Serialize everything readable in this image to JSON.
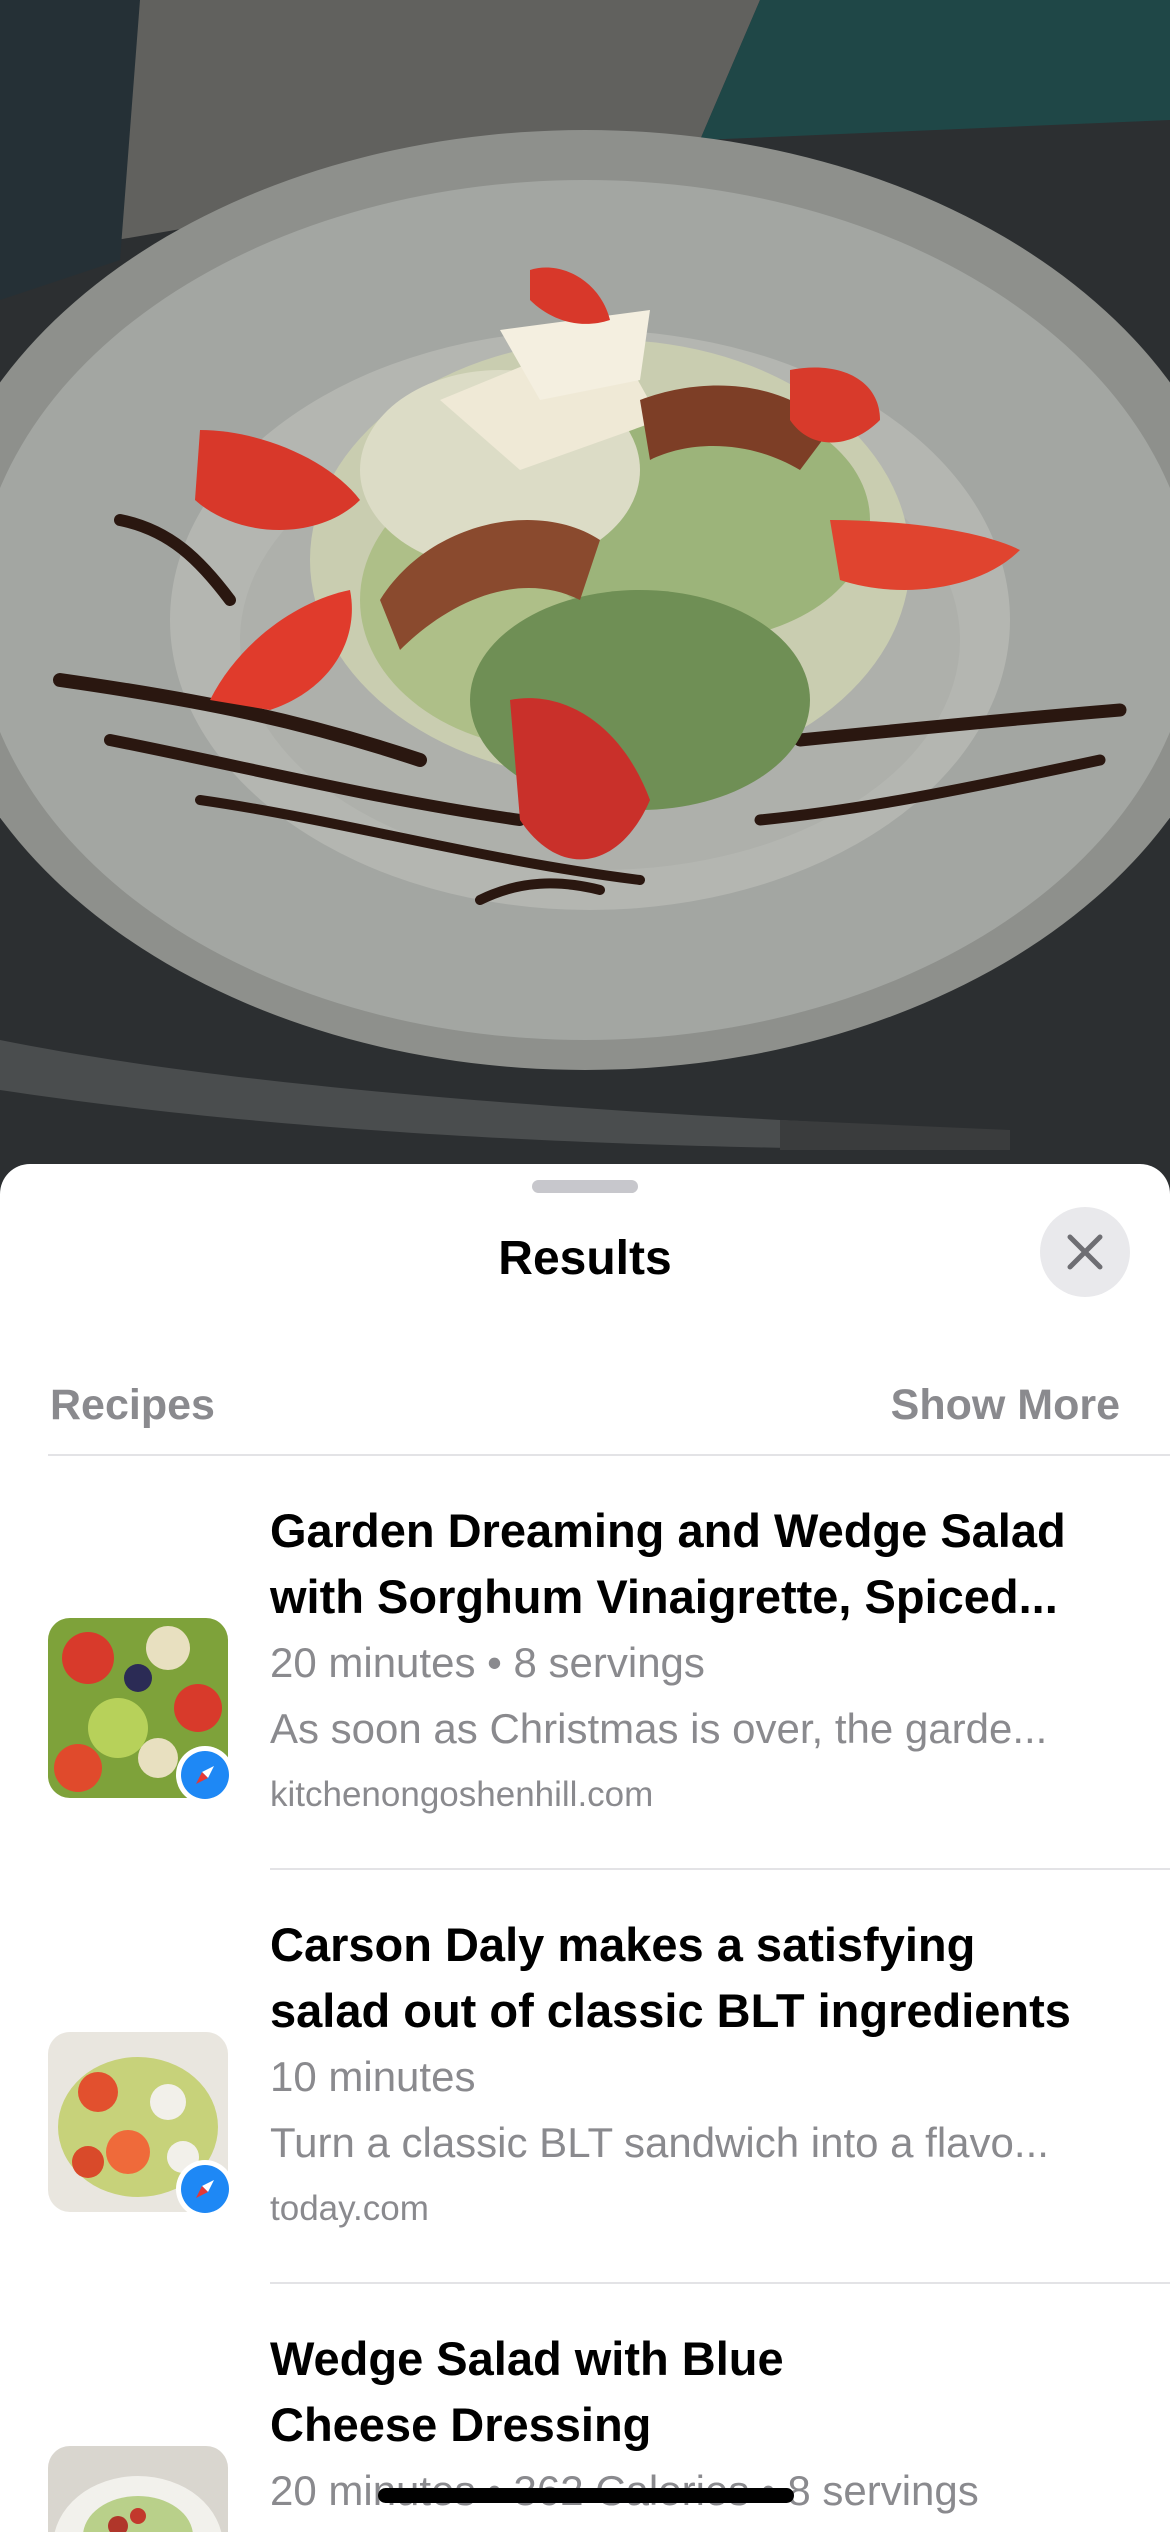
{
  "sheet": {
    "title": "Results",
    "close_icon": "close-x-icon"
  },
  "section": {
    "label": "Recipes",
    "show_more": "Show More"
  },
  "results": [
    {
      "title_line1": "Garden Dreaming and Wedge Salad",
      "title_line2": "with Sorghum Vinaigrette, Spiced...",
      "meta": "20 minutes • 8 servings",
      "description": "As soon as Christmas is over, the garde...",
      "source": "kitchenongoshenhill.com",
      "source_icon": "safari-compass-icon"
    },
    {
      "title_line1": "Carson Daly makes a satisfying",
      "title_line2": "salad out of classic BLT ingredients",
      "meta": "10 minutes",
      "description": "Turn a classic BLT sandwich into a flavo...",
      "source": "today.com",
      "source_icon": "safari-compass-icon"
    },
    {
      "title_line1": "Wedge Salad with Blue",
      "title_line2": "Cheese Dressing",
      "meta": "20 minutes • 362 Calories • 8 servings"
    }
  ]
}
